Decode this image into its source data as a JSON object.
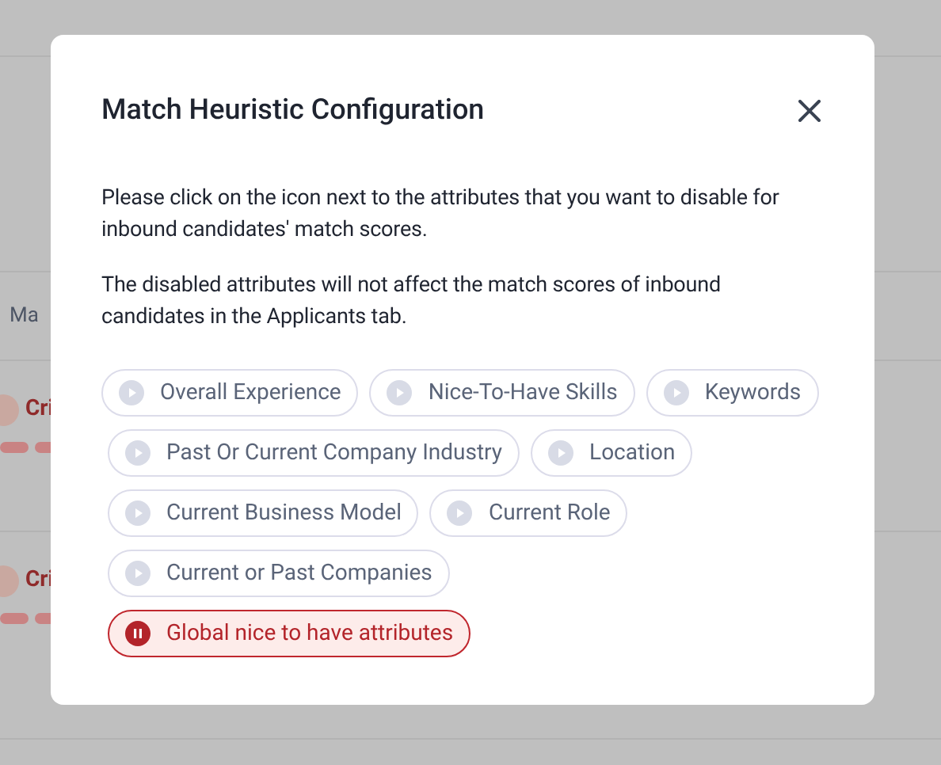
{
  "background": {
    "header_text": "Ma",
    "rows": [
      {
        "label": "Cri"
      },
      {
        "label": "Cri"
      }
    ]
  },
  "dialog": {
    "title": "Match Heuristic Configuration",
    "paragraphs": [
      "Please click on the icon next to the attributes that you want to disable for inbound candidates' match scores.",
      "The disabled attributes will not affect the match scores of inbound candidates in the Applicants tab."
    ],
    "attribute_rows": [
      [
        {
          "label": "Overall Experience",
          "disabled": false
        },
        {
          "label": "Nice-To-Have Skills",
          "disabled": false
        },
        {
          "label": "Keywords",
          "disabled": false
        }
      ],
      [
        {
          "label": "Past Or Current Company Industry",
          "disabled": false
        },
        {
          "label": "Location",
          "disabled": false
        }
      ],
      [
        {
          "label": "Current Business Model",
          "disabled": false
        },
        {
          "label": "Current Role",
          "disabled": false
        }
      ],
      [
        {
          "label": "Current or Past Companies",
          "disabled": false
        }
      ],
      [
        {
          "label": "Global nice to have attributes",
          "disabled": true
        }
      ]
    ]
  }
}
